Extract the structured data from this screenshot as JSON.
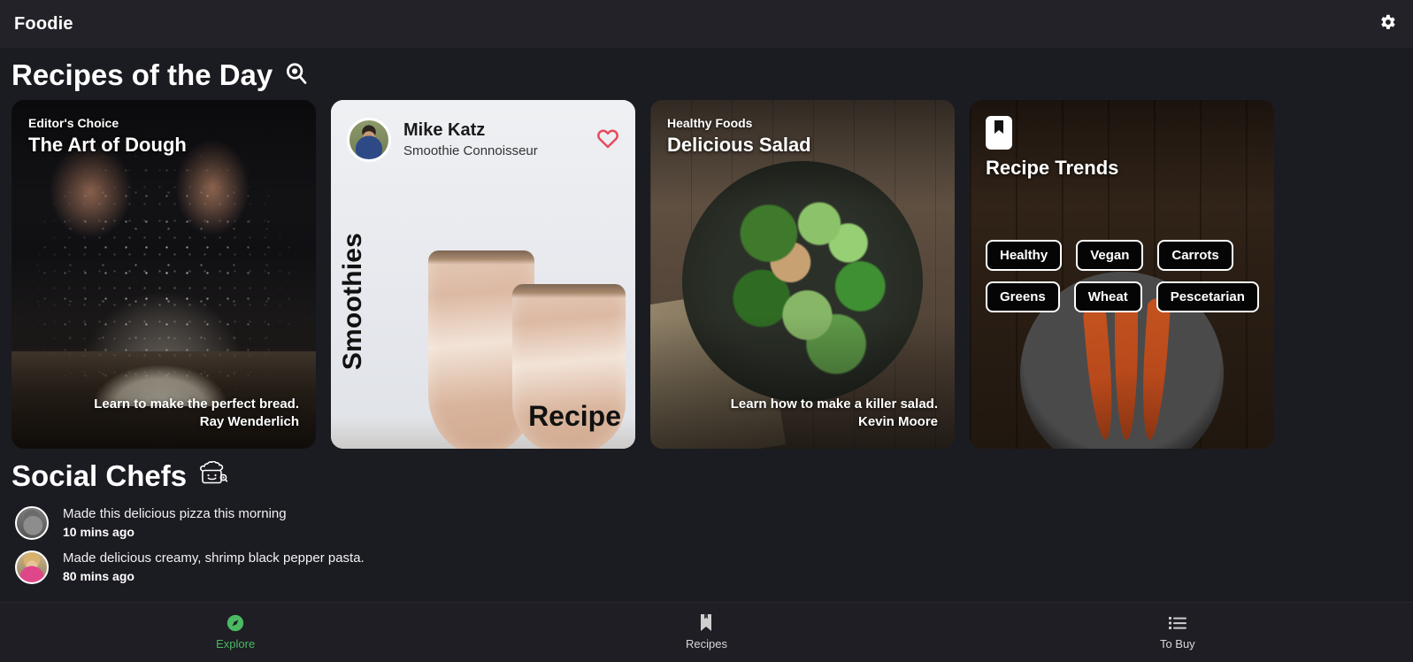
{
  "app": {
    "title": "Foodie",
    "settings_icon": "gear-icon",
    "accent_green": "#4cb963",
    "accent_red": "#e8495a",
    "background": "#1b1b22",
    "topbar_background": "#222228"
  },
  "sections": {
    "recipes_of_the_day": {
      "title": "Recipes of the Day",
      "icon": "search-icon"
    },
    "social_chefs": {
      "title": "Social Chefs",
      "icon": "chef-hat-icon"
    }
  },
  "cards": [
    {
      "kicker": "Editor's Choice",
      "title": "The Art of Dough",
      "description": "Learn to make the perfect bread.",
      "author": "Ray Wenderlich"
    },
    {
      "chef_name": "Mike Katz",
      "chef_role": "Smoothie Connoisseur",
      "favorite_icon": "heart-outline-icon",
      "category": "Smoothies",
      "action_label": "Recipe"
    },
    {
      "kicker": "Healthy Foods",
      "title": "Delicious Salad",
      "description": "Learn how to make a killer salad.",
      "author": "Kevin Moore"
    },
    {
      "badge_icon": "bookmark-icon",
      "title": "Recipe Trends",
      "tags": [
        "Healthy",
        "Vegan",
        "Carrots",
        "Greens",
        "Wheat",
        "Pescetarian"
      ]
    }
  ],
  "feed": [
    {
      "message": "Made this delicious pizza this morning",
      "time": "10 mins ago",
      "avatar": "avatar-chef-1"
    },
    {
      "message": "Made delicious creamy, shrimp black pepper pasta.",
      "time": "80 mins ago",
      "avatar": "avatar-chef-2"
    }
  ],
  "bottom_nav": [
    {
      "label": "Explore",
      "icon": "compass-icon",
      "active": true
    },
    {
      "label": "Recipes",
      "icon": "bookmark-icon",
      "active": false
    },
    {
      "label": "To Buy",
      "icon": "list-icon",
      "active": false
    }
  ]
}
